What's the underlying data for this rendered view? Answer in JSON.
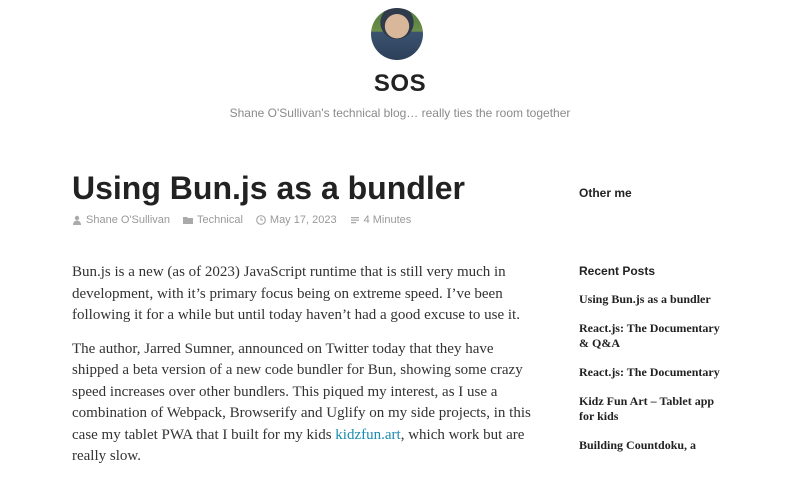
{
  "header": {
    "site_title": "SOS",
    "site_description": "Shane O'Sullivan's technical blog… really ties the room together"
  },
  "post": {
    "title": "Using Bun.js as a bundler",
    "meta": {
      "author": "Shane O'Sullivan",
      "category": "Technical",
      "date": "May 17, 2023",
      "read_time": "4 Minutes"
    },
    "paragraphs": [
      "Bun.js is a new (as of 2023) JavaScript runtime that is still very much in development, with it’s primary focus being on extreme speed. I’ve been following it for a while but until today haven’t had a good excuse to use it.",
      {
        "before": "The author, Jarred Sumner, announced on Twitter today that they have shipped a beta version of a new code bundler for Bun, showing some crazy speed increases over other bundlers. This piqued my interest, as I use a combination of Webpack, Browserify and Uglify on my side projects, in this case my tablet PWA that I built for my kids ",
        "link": "kidzfun.art",
        "after": ", which work but are really slow."
      }
    ]
  },
  "sidebar": {
    "other_me_title": "Other me",
    "recent_posts_title": "Recent Posts",
    "recent_posts": [
      "Using Bun.js as a bundler",
      "React.js: The Documentary & Q&A",
      "React.js: The Documentary",
      "Kidz Fun Art – Tablet app for kids",
      "Building Countdoku, a"
    ]
  },
  "colors": {
    "link": "#1a8cb0",
    "meta_gray": "#999999"
  },
  "icons": [
    "user-icon",
    "folder-icon",
    "clock-icon",
    "reading-time-icon"
  ]
}
